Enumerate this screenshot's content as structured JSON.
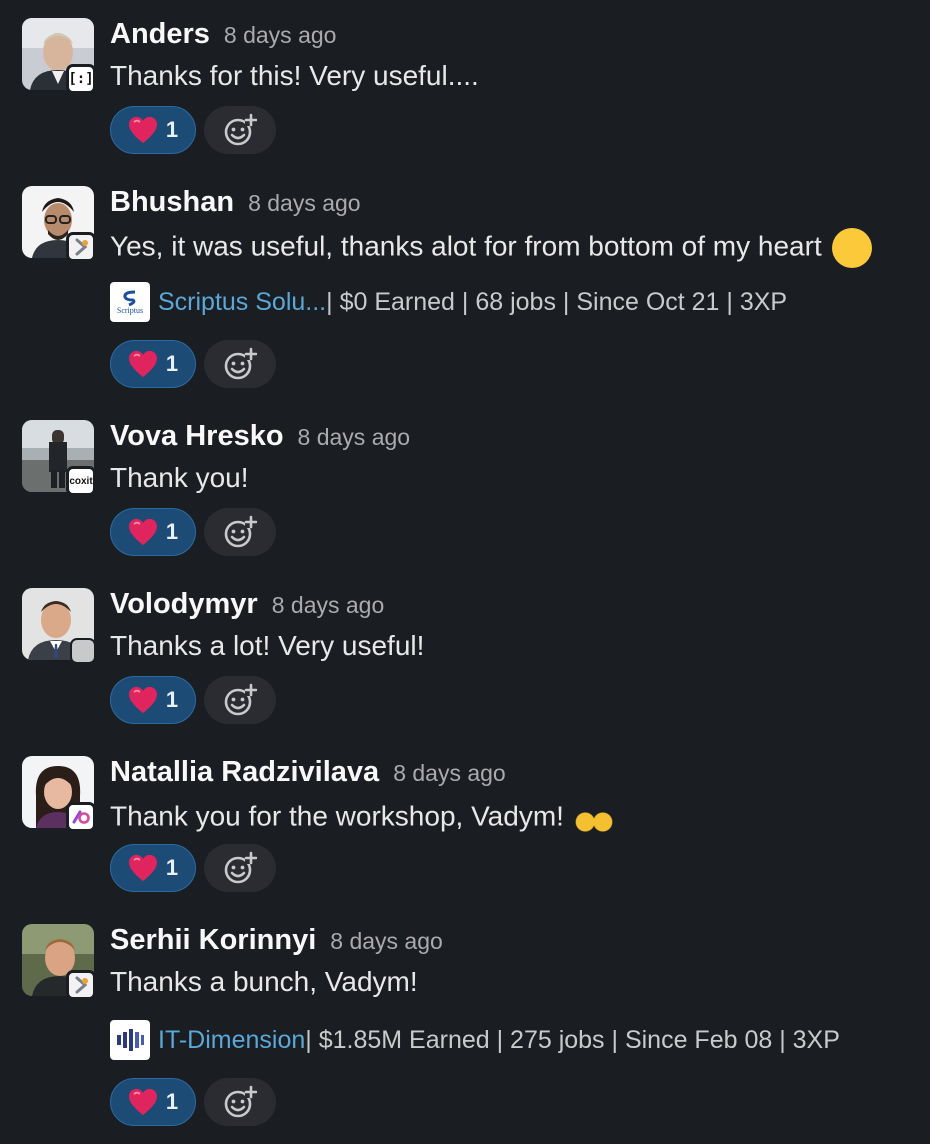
{
  "messages": [
    {
      "name": "Anders",
      "time": "8 days ago",
      "text": "Thanks for this! Very useful....",
      "badge_text": "[:]",
      "reaction": {
        "emoji": "heart",
        "count": "1"
      }
    },
    {
      "name": "Bhushan",
      "time": "8 days ago",
      "text": "Yes, it was useful, thanks alot for from bottom of my heart",
      "emoji": "🙂",
      "company": {
        "logo_text": "Scriptus",
        "name": "Scriptus Solu...",
        "stats": " | $0 Earned | 68 jobs | Since Oct 21 | 3XP"
      },
      "reaction": {
        "emoji": "heart",
        "count": "1"
      }
    },
    {
      "name": "Vova Hresko",
      "time": "8 days ago",
      "text": "Thank you!",
      "badge_text": "coxit",
      "reaction": {
        "emoji": "heart",
        "count": "1"
      }
    },
    {
      "name": "Volodymyr",
      "time": "8 days ago",
      "text": "Thanks a lot! Very useful!",
      "reaction": {
        "emoji": "heart",
        "count": "1"
      }
    },
    {
      "name": "Natallia Radzivilava",
      "time": "8 days ago",
      "text": "Thank you for the workshop, Vadym!",
      "emoji": "🙌",
      "reaction": {
        "emoji": "heart",
        "count": "1"
      }
    },
    {
      "name": "Serhii Korinnyi",
      "time": "8 days ago",
      "text": "Thanks a bunch, Vadym!",
      "company": {
        "name": "IT-Dimension",
        "stats": " | $1.85M Earned | 275 jobs | Since Feb 08 | 3XP"
      },
      "reaction": {
        "emoji": "heart",
        "count": "1"
      }
    }
  ],
  "colors": {
    "background": "#1a1d21",
    "reaction_bg": "#1c4b75",
    "link": "#5aa7d8",
    "heart": "#e0245e"
  }
}
